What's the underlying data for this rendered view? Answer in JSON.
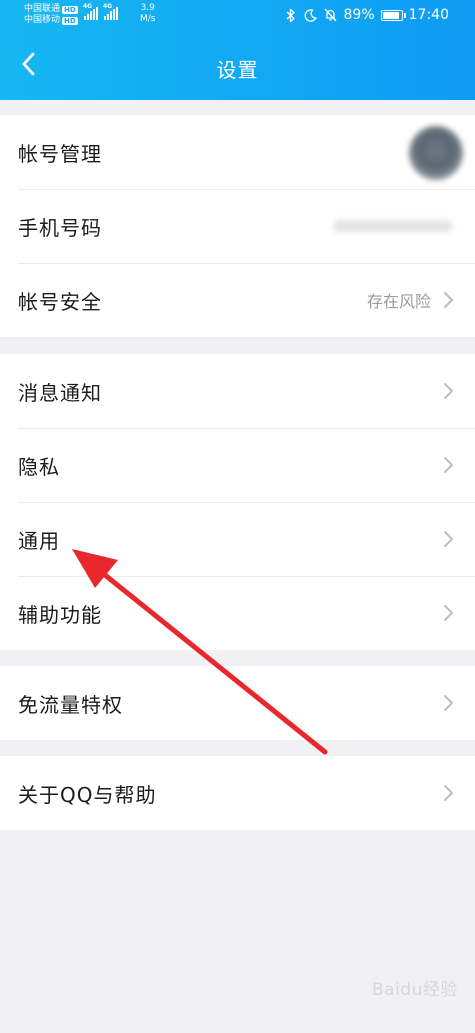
{
  "status_bar": {
    "carrier_1": "中国联通",
    "carrier_2": "中国移动",
    "hd_badge": "HD",
    "network_1": "4G",
    "network_2": "4G",
    "speed_value": "3.9",
    "speed_unit": "M/s",
    "battery_percent": "89%",
    "battery_level": 0.89,
    "time": "17:40",
    "icons": [
      "bluetooth-icon",
      "moon-icon",
      "mute-bell-icon",
      "battery-icon"
    ]
  },
  "nav": {
    "title": "设置",
    "back_icon": "chevron-left-icon"
  },
  "groups": {
    "account": {
      "account_management": "帐号管理",
      "phone_number": "手机号码",
      "account_security": "帐号安全",
      "account_security_status": "存在风险"
    },
    "general": {
      "notifications": "消息通知",
      "privacy": "隐私",
      "general": "通用",
      "accessibility": "辅助功能"
    },
    "data": {
      "free_data": "免流量特权"
    },
    "about": {
      "about_help": "关于QQ与帮助"
    }
  },
  "colors": {
    "header_start": "#16b7f2",
    "header_end": "#0f9bf2",
    "annotation_arrow": "#e8282c",
    "page_background": "#f1f1f4"
  },
  "watermark": "Baidu经验"
}
